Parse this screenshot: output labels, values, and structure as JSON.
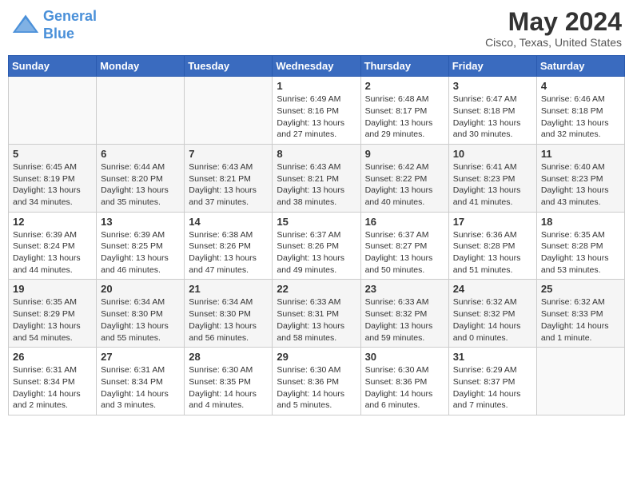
{
  "logo": {
    "line1": "General",
    "line2": "Blue"
  },
  "title": "May 2024",
  "location": "Cisco, Texas, United States",
  "days_of_week": [
    "Sunday",
    "Monday",
    "Tuesday",
    "Wednesday",
    "Thursday",
    "Friday",
    "Saturday"
  ],
  "weeks": [
    [
      {
        "day": "",
        "content": ""
      },
      {
        "day": "",
        "content": ""
      },
      {
        "day": "",
        "content": ""
      },
      {
        "day": "1",
        "content": "Sunrise: 6:49 AM\nSunset: 8:16 PM\nDaylight: 13 hours\nand 27 minutes."
      },
      {
        "day": "2",
        "content": "Sunrise: 6:48 AM\nSunset: 8:17 PM\nDaylight: 13 hours\nand 29 minutes."
      },
      {
        "day": "3",
        "content": "Sunrise: 6:47 AM\nSunset: 8:18 PM\nDaylight: 13 hours\nand 30 minutes."
      },
      {
        "day": "4",
        "content": "Sunrise: 6:46 AM\nSunset: 8:18 PM\nDaylight: 13 hours\nand 32 minutes."
      }
    ],
    [
      {
        "day": "5",
        "content": "Sunrise: 6:45 AM\nSunset: 8:19 PM\nDaylight: 13 hours\nand 34 minutes."
      },
      {
        "day": "6",
        "content": "Sunrise: 6:44 AM\nSunset: 8:20 PM\nDaylight: 13 hours\nand 35 minutes."
      },
      {
        "day": "7",
        "content": "Sunrise: 6:43 AM\nSunset: 8:21 PM\nDaylight: 13 hours\nand 37 minutes."
      },
      {
        "day": "8",
        "content": "Sunrise: 6:43 AM\nSunset: 8:21 PM\nDaylight: 13 hours\nand 38 minutes."
      },
      {
        "day": "9",
        "content": "Sunrise: 6:42 AM\nSunset: 8:22 PM\nDaylight: 13 hours\nand 40 minutes."
      },
      {
        "day": "10",
        "content": "Sunrise: 6:41 AM\nSunset: 8:23 PM\nDaylight: 13 hours\nand 41 minutes."
      },
      {
        "day": "11",
        "content": "Sunrise: 6:40 AM\nSunset: 8:23 PM\nDaylight: 13 hours\nand 43 minutes."
      }
    ],
    [
      {
        "day": "12",
        "content": "Sunrise: 6:39 AM\nSunset: 8:24 PM\nDaylight: 13 hours\nand 44 minutes."
      },
      {
        "day": "13",
        "content": "Sunrise: 6:39 AM\nSunset: 8:25 PM\nDaylight: 13 hours\nand 46 minutes."
      },
      {
        "day": "14",
        "content": "Sunrise: 6:38 AM\nSunset: 8:26 PM\nDaylight: 13 hours\nand 47 minutes."
      },
      {
        "day": "15",
        "content": "Sunrise: 6:37 AM\nSunset: 8:26 PM\nDaylight: 13 hours\nand 49 minutes."
      },
      {
        "day": "16",
        "content": "Sunrise: 6:37 AM\nSunset: 8:27 PM\nDaylight: 13 hours\nand 50 minutes."
      },
      {
        "day": "17",
        "content": "Sunrise: 6:36 AM\nSunset: 8:28 PM\nDaylight: 13 hours\nand 51 minutes."
      },
      {
        "day": "18",
        "content": "Sunrise: 6:35 AM\nSunset: 8:28 PM\nDaylight: 13 hours\nand 53 minutes."
      }
    ],
    [
      {
        "day": "19",
        "content": "Sunrise: 6:35 AM\nSunset: 8:29 PM\nDaylight: 13 hours\nand 54 minutes."
      },
      {
        "day": "20",
        "content": "Sunrise: 6:34 AM\nSunset: 8:30 PM\nDaylight: 13 hours\nand 55 minutes."
      },
      {
        "day": "21",
        "content": "Sunrise: 6:34 AM\nSunset: 8:30 PM\nDaylight: 13 hours\nand 56 minutes."
      },
      {
        "day": "22",
        "content": "Sunrise: 6:33 AM\nSunset: 8:31 PM\nDaylight: 13 hours\nand 58 minutes."
      },
      {
        "day": "23",
        "content": "Sunrise: 6:33 AM\nSunset: 8:32 PM\nDaylight: 13 hours\nand 59 minutes."
      },
      {
        "day": "24",
        "content": "Sunrise: 6:32 AM\nSunset: 8:32 PM\nDaylight: 14 hours\nand 0 minutes."
      },
      {
        "day": "25",
        "content": "Sunrise: 6:32 AM\nSunset: 8:33 PM\nDaylight: 14 hours\nand 1 minute."
      }
    ],
    [
      {
        "day": "26",
        "content": "Sunrise: 6:31 AM\nSunset: 8:34 PM\nDaylight: 14 hours\nand 2 minutes."
      },
      {
        "day": "27",
        "content": "Sunrise: 6:31 AM\nSunset: 8:34 PM\nDaylight: 14 hours\nand 3 minutes."
      },
      {
        "day": "28",
        "content": "Sunrise: 6:30 AM\nSunset: 8:35 PM\nDaylight: 14 hours\nand 4 minutes."
      },
      {
        "day": "29",
        "content": "Sunrise: 6:30 AM\nSunset: 8:36 PM\nDaylight: 14 hours\nand 5 minutes."
      },
      {
        "day": "30",
        "content": "Sunrise: 6:30 AM\nSunset: 8:36 PM\nDaylight: 14 hours\nand 6 minutes."
      },
      {
        "day": "31",
        "content": "Sunrise: 6:29 AM\nSunset: 8:37 PM\nDaylight: 14 hours\nand 7 minutes."
      },
      {
        "day": "",
        "content": ""
      }
    ]
  ]
}
